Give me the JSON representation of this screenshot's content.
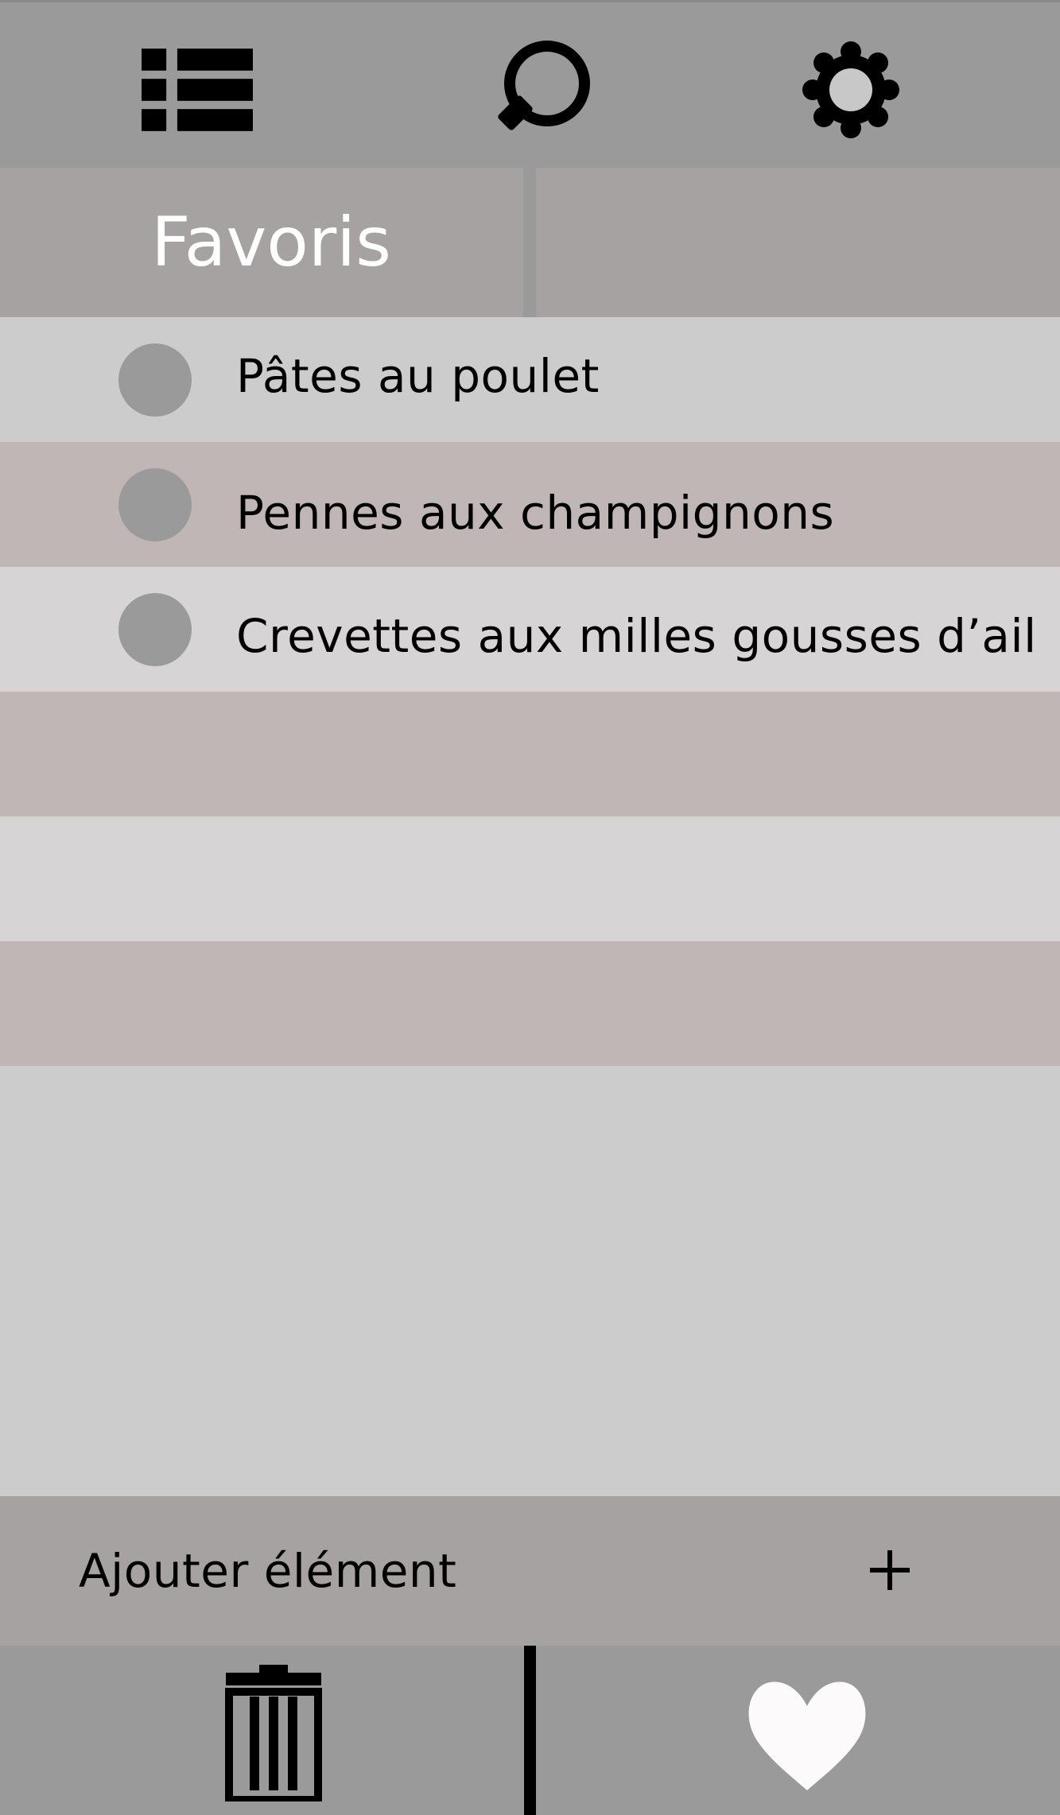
{
  "toolbar": {
    "icons": [
      "list-icon",
      "search-icon",
      "gear-icon"
    ]
  },
  "tabs": {
    "favorites_label": "Favoris"
  },
  "list": {
    "items": [
      {
        "label": "Pâtes au poulet"
      },
      {
        "label": "Pennes aux champignons"
      },
      {
        "label": "Crevettes aux milles gousses d’ail"
      }
    ]
  },
  "add_bar": {
    "label": "Ajouter élément",
    "icon": "plus-icon"
  },
  "bottom_bar": {
    "icons": [
      "trash-icon",
      "heart-icon"
    ]
  },
  "colors": {
    "toolbar_bg": "#9a9a9a",
    "tab_bg": "#a5a2a1",
    "row_light": "#cccccc",
    "row_pink": "#c0b6b5",
    "row_pale": "#d6d4d5",
    "bullet": "#9a9a9a",
    "heart": "#fcfafa"
  }
}
